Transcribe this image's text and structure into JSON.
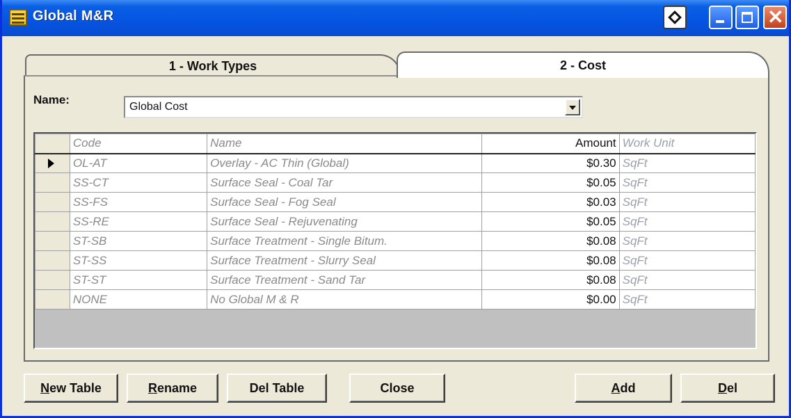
{
  "window": {
    "title": "Global M&R",
    "accent": "#0554e2"
  },
  "tabs": [
    {
      "label": "1 - Work Types",
      "active": false
    },
    {
      "label": "2 - Cost",
      "active": true
    }
  ],
  "name_field": {
    "label": "Name:",
    "value": "Global Cost"
  },
  "table": {
    "columns": [
      "Code",
      "Name",
      "Amount",
      "Work Unit"
    ],
    "rows": [
      {
        "code": "OL-AT",
        "name": "Overlay - AC Thin (Global)",
        "amount": "$0.30",
        "unit": "SqFt",
        "current": true
      },
      {
        "code": "SS-CT",
        "name": "Surface Seal - Coal Tar",
        "amount": "$0.05",
        "unit": "SqFt"
      },
      {
        "code": "SS-FS",
        "name": "Surface Seal - Fog Seal",
        "amount": "$0.03",
        "unit": "SqFt"
      },
      {
        "code": "SS-RE",
        "name": "Surface Seal - Rejuvenating",
        "amount": "$0.05",
        "unit": "SqFt"
      },
      {
        "code": "ST-SB",
        "name": "Surface Treatment - Single Bitum.",
        "amount": "$0.08",
        "unit": "SqFt"
      },
      {
        "code": "ST-SS",
        "name": "Surface Treatment - Slurry Seal",
        "amount": "$0.08",
        "unit": "SqFt"
      },
      {
        "code": "ST-ST",
        "name": "Surface Treatment - Sand Tar",
        "amount": "$0.08",
        "unit": "SqFt"
      },
      {
        "code": "NONE",
        "name": "No Global M & R",
        "amount": "$0.00",
        "unit": "SqFt"
      }
    ]
  },
  "buttons": {
    "new_table": {
      "first": "N",
      "rest": "ew Table"
    },
    "rename": {
      "first": "R",
      "rest": "ename"
    },
    "del_table": "Del Table",
    "close": "Close",
    "add": {
      "first": "A",
      "rest": "dd"
    },
    "del": {
      "first": "D",
      "rest": "el"
    }
  }
}
